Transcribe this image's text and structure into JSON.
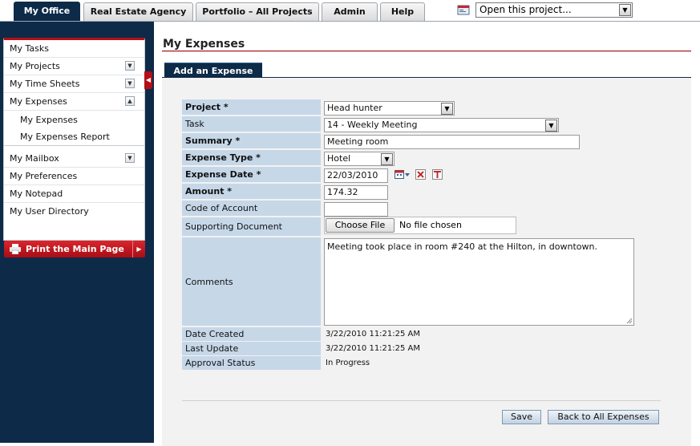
{
  "tabs": [
    {
      "label": "My Office",
      "active": true
    },
    {
      "label": "Real Estate Agency",
      "active": false
    },
    {
      "label": "Portfolio – All Projects",
      "active": false
    },
    {
      "label": "Admin",
      "active": false
    },
    {
      "label": "Help",
      "active": false
    }
  ],
  "open_project": {
    "value": "Open this project..."
  },
  "sidebar": {
    "items": [
      {
        "label": "My Tasks"
      },
      {
        "label": "My Projects"
      },
      {
        "label": "My Time Sheets"
      },
      {
        "label": "My Expenses"
      },
      {
        "label": "My Expenses"
      },
      {
        "label": "My Expenses Report"
      },
      {
        "label": "My Mailbox"
      },
      {
        "label": "My Preferences"
      },
      {
        "label": "My Notepad"
      },
      {
        "label": "My User Directory"
      }
    ],
    "print_label": "Print the Main Page"
  },
  "main": {
    "title": "My Expenses",
    "subtab": "Add an Expense"
  },
  "form": {
    "labels": {
      "project": "Project *",
      "task": "Task",
      "summary": "Summary *",
      "expense_type": "Expense Type *",
      "expense_date": "Expense Date *",
      "amount": "Amount *",
      "code_of_account": "Code of Account",
      "supporting_document": "Supporting Document",
      "comments": "Comments",
      "date_created": "Date Created",
      "last_update": "Last Update",
      "approval_status": "Approval Status"
    },
    "values": {
      "project": "Head hunter",
      "task": "14 - Weekly Meeting",
      "summary": "Meeting room",
      "expense_type": "Hotel",
      "expense_date": "22/03/2010",
      "amount": "174.32",
      "code_of_account": "",
      "choose_file": "Choose File",
      "no_file": "No file chosen",
      "comments": "Meeting took place in room #240 at the Hilton, in downtown.",
      "date_created": "3/22/2010 11:21:25 AM",
      "last_update": "3/22/2010 11:21:25 AM",
      "approval_status": "In Progress"
    }
  },
  "buttons": {
    "save": "Save",
    "back": "Back to All Expenses"
  },
  "colors": {
    "navy": "#0d2a48",
    "accent_red": "#b40f17",
    "label_blue": "#c6d7e8"
  }
}
